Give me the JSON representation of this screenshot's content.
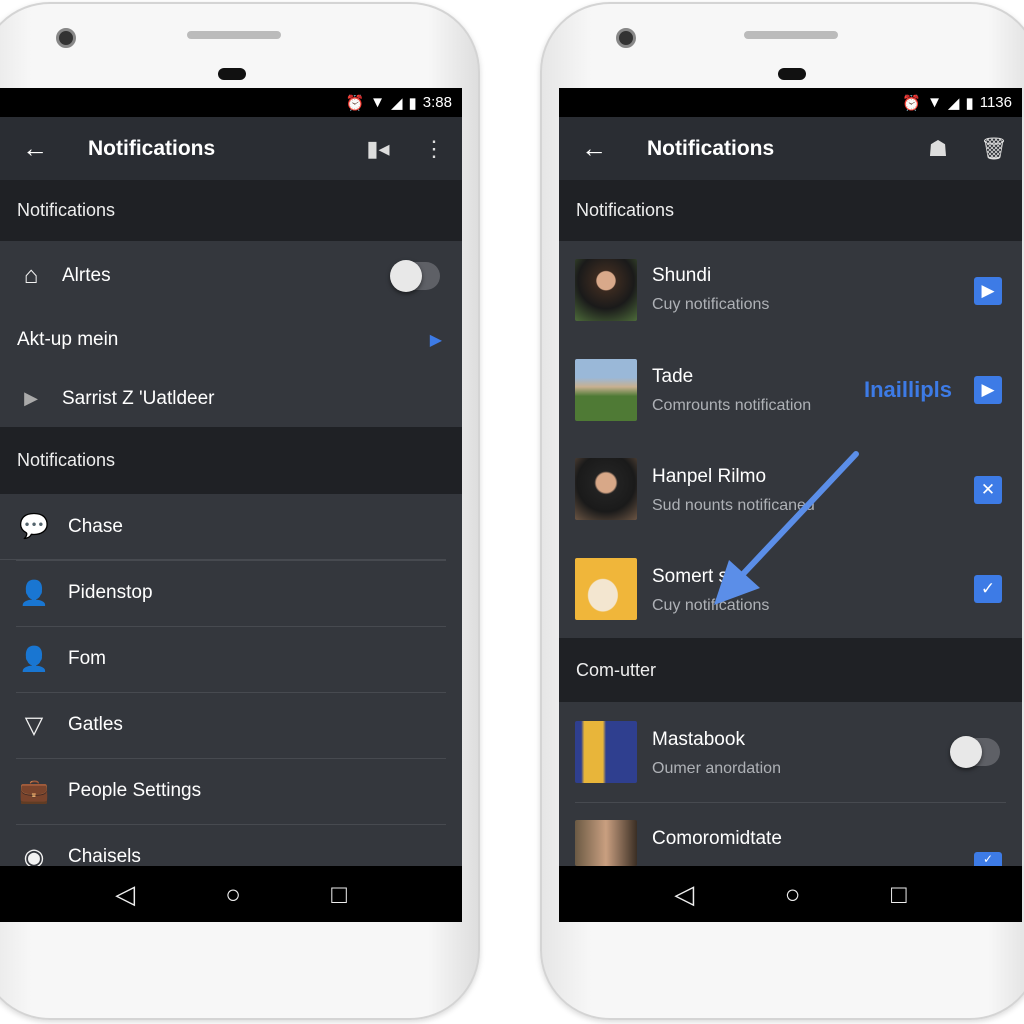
{
  "left": {
    "status": {
      "time": "3:88",
      "icons": [
        "alarm-icon",
        "wifi-icon",
        "signal-icon",
        "battery-icon"
      ]
    },
    "appbar": {
      "title": "Notifications",
      "actions": [
        "video-icon",
        "more-icon"
      ]
    },
    "section1": "Notifications",
    "settings": [
      {
        "icon": "home-icon",
        "label": "Alrtes",
        "toggle": false
      },
      {
        "label": "Akt-up mein",
        "chevron_color": "#3d7be6"
      },
      {
        "icon": "play-icon",
        "label": "Sarrist Z 'Uatldeer"
      }
    ],
    "section2": "Notifications",
    "list": [
      {
        "icon": "chat-icon",
        "label": "Chase"
      },
      {
        "icon": "person-icon",
        "label": "Pidenstop"
      },
      {
        "icon": "person-icon",
        "label": "Fom"
      },
      {
        "icon": "triangle-icon",
        "label": "Gatles"
      },
      {
        "icon": "briefcase-icon",
        "label": "People Settings"
      },
      {
        "icon": "circle-icon",
        "label": "Chaisels"
      }
    ]
  },
  "right": {
    "status": {
      "time": "1136"
    },
    "appbar": {
      "title": "Notifications",
      "actions": [
        "bag-icon",
        "trash-icon"
      ]
    },
    "section1": "Notifications",
    "items": [
      {
        "name": "Shundi",
        "sub": "Cuy notifications",
        "badge": "play-icon"
      },
      {
        "name": "Tade",
        "sub": "Comrounts notification",
        "badge": "chat-play-icon",
        "label": "Inaillipls"
      },
      {
        "name": "Hanpel Rilmo",
        "sub": "Sud nounts notificaned",
        "badge": "close-icon"
      },
      {
        "name": "Somert s",
        "sub": "Cuy notifications",
        "badge": "check-icon"
      }
    ],
    "section2": "Com-utter",
    "items2": [
      {
        "name": "Mastabook",
        "sub": "Oumer anordation",
        "toggle": false
      },
      {
        "name": "Comoromidtate",
        "badge": "check-icon"
      }
    ]
  },
  "colors": {
    "accent": "#3d7be6",
    "background": "#34373d",
    "header": "#1f2125"
  }
}
